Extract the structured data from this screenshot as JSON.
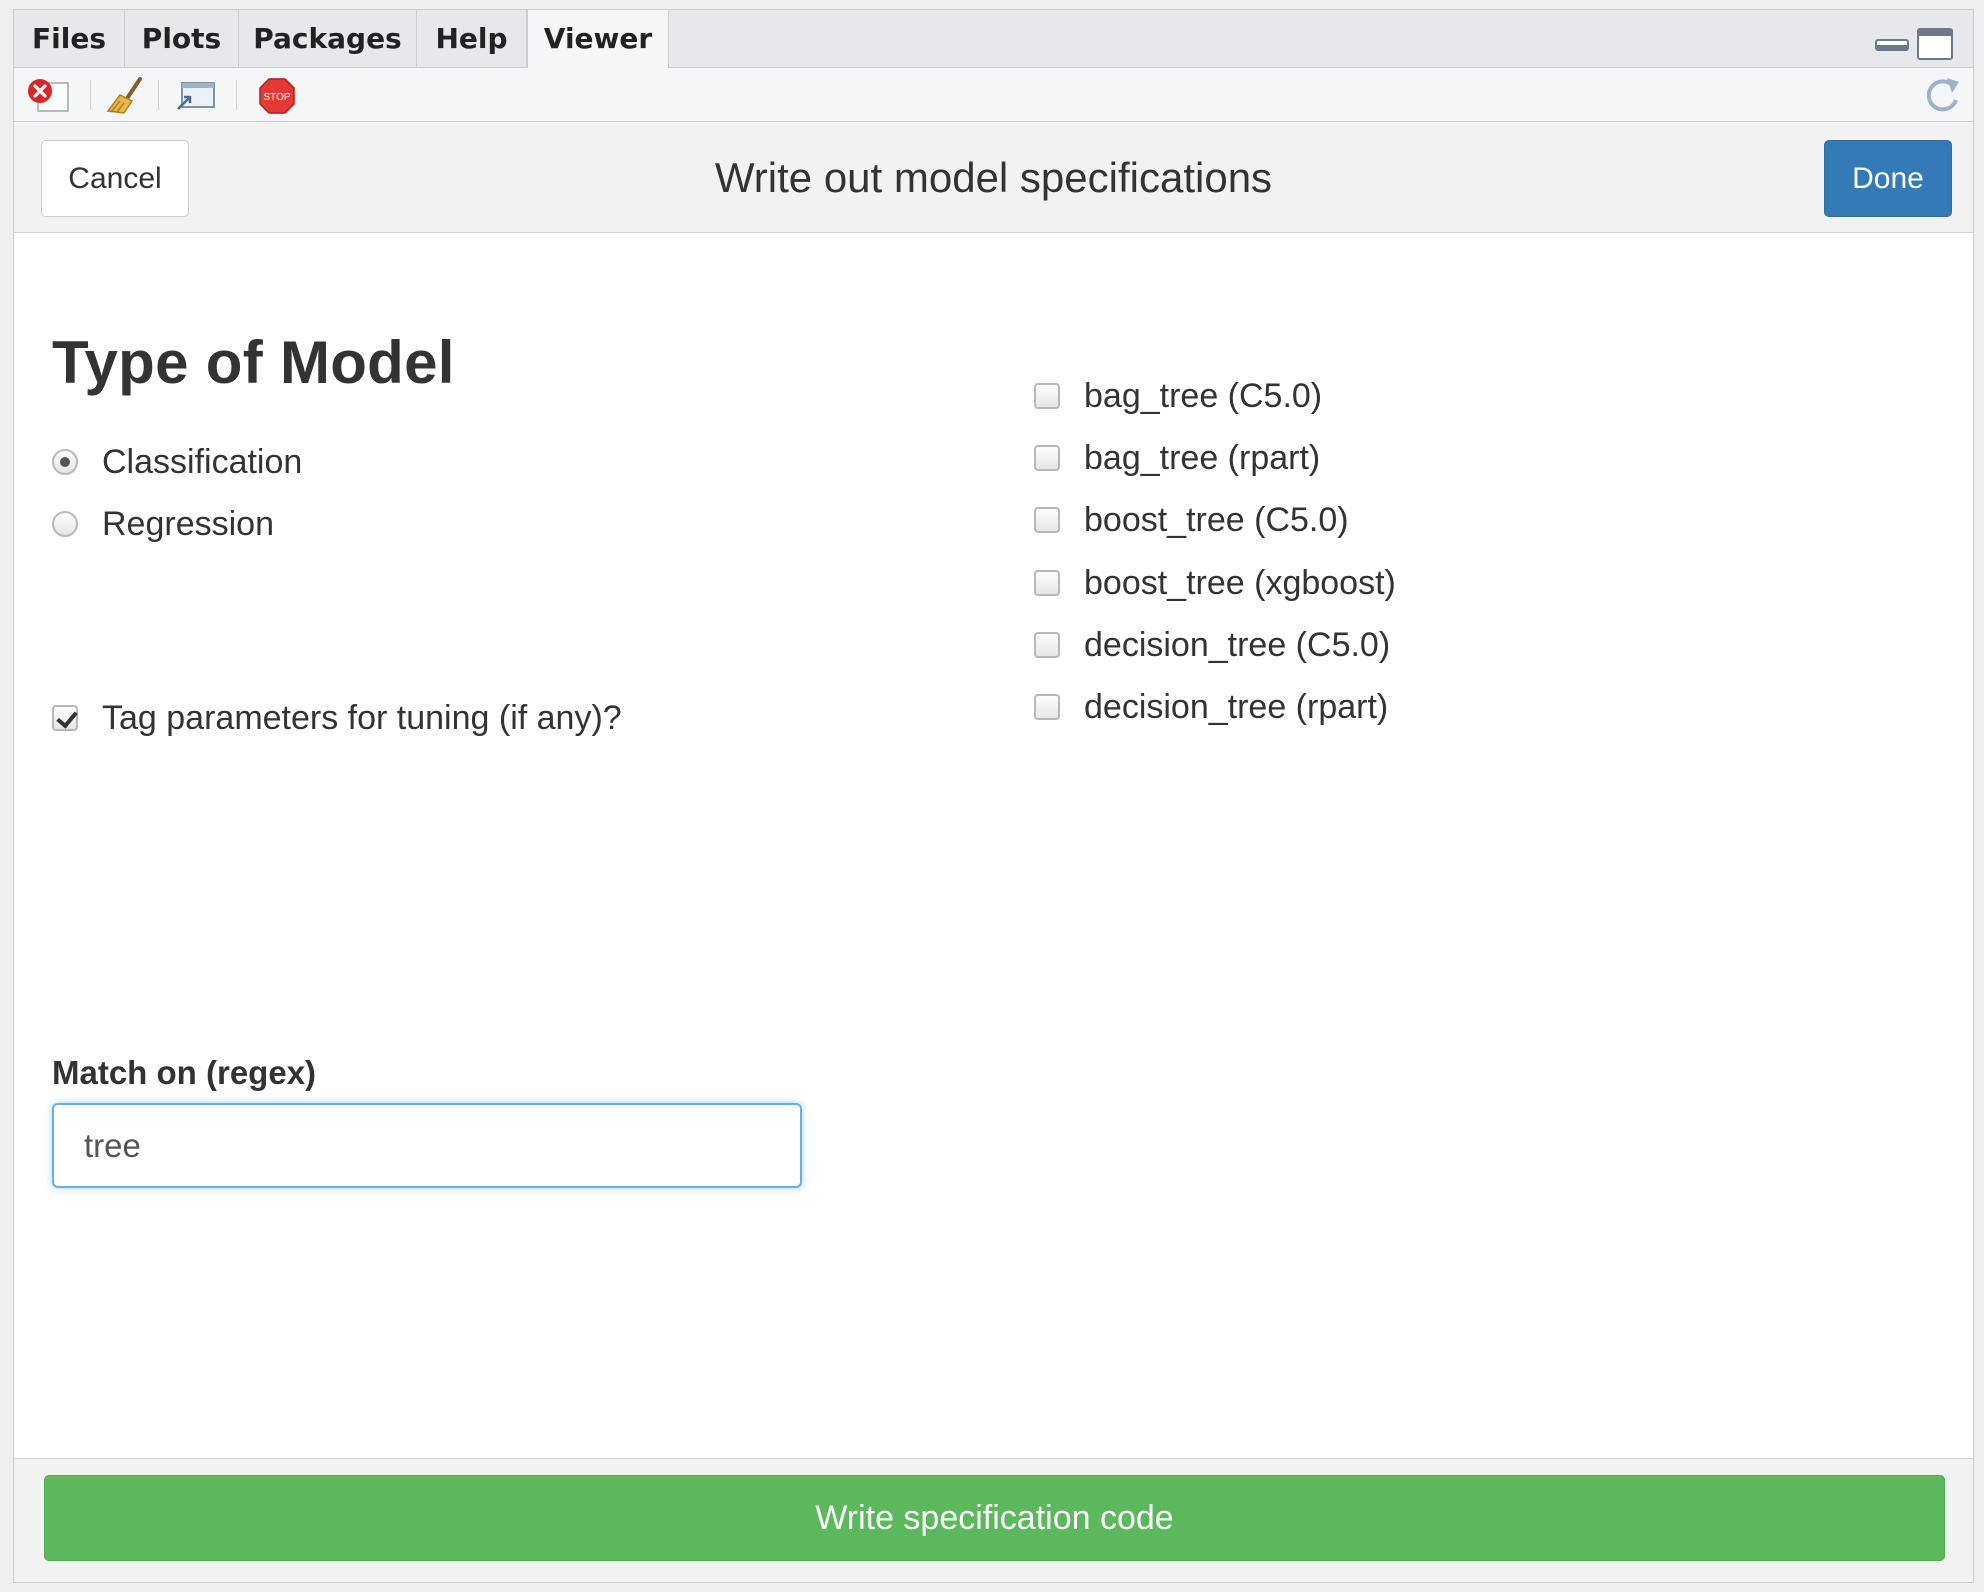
{
  "tabs": [
    {
      "label": "Files"
    },
    {
      "label": "Plots"
    },
    {
      "label": "Packages"
    },
    {
      "label": "Help"
    },
    {
      "label": "Viewer"
    }
  ],
  "active_tab": "Viewer",
  "toolbar": {
    "icons": [
      "remove-viewer-icon",
      "clear-all-icon",
      "show-in-new-window-icon",
      "stop-icon",
      "refresh-icon"
    ],
    "stop_text": "STOP"
  },
  "gadget": {
    "cancel_label": "Cancel",
    "title": "Write out model specifications",
    "done_label": "Done"
  },
  "model_type": {
    "heading": "Type of Model",
    "options": [
      {
        "label": "Classification",
        "selected": true
      },
      {
        "label": "Regression",
        "selected": false
      }
    ]
  },
  "tag_params": {
    "label": "Tag parameters for tuning (if any)?",
    "checked": true
  },
  "models": [
    {
      "label": "bag_tree (C5.0)",
      "checked": false
    },
    {
      "label": "bag_tree (rpart)",
      "checked": false
    },
    {
      "label": "boost_tree (C5.0)",
      "checked": false
    },
    {
      "label": "boost_tree (xgboost)",
      "checked": false
    },
    {
      "label": "decision_tree (C5.0)",
      "checked": false
    },
    {
      "label": "decision_tree (rpart)",
      "checked": false
    }
  ],
  "regex": {
    "label": "Match on (regex)",
    "value": "tree"
  },
  "write_button": "Write specification code",
  "colors": {
    "primary": "#337ab7",
    "success": "#5cb85c",
    "focus": "#66afe9"
  }
}
